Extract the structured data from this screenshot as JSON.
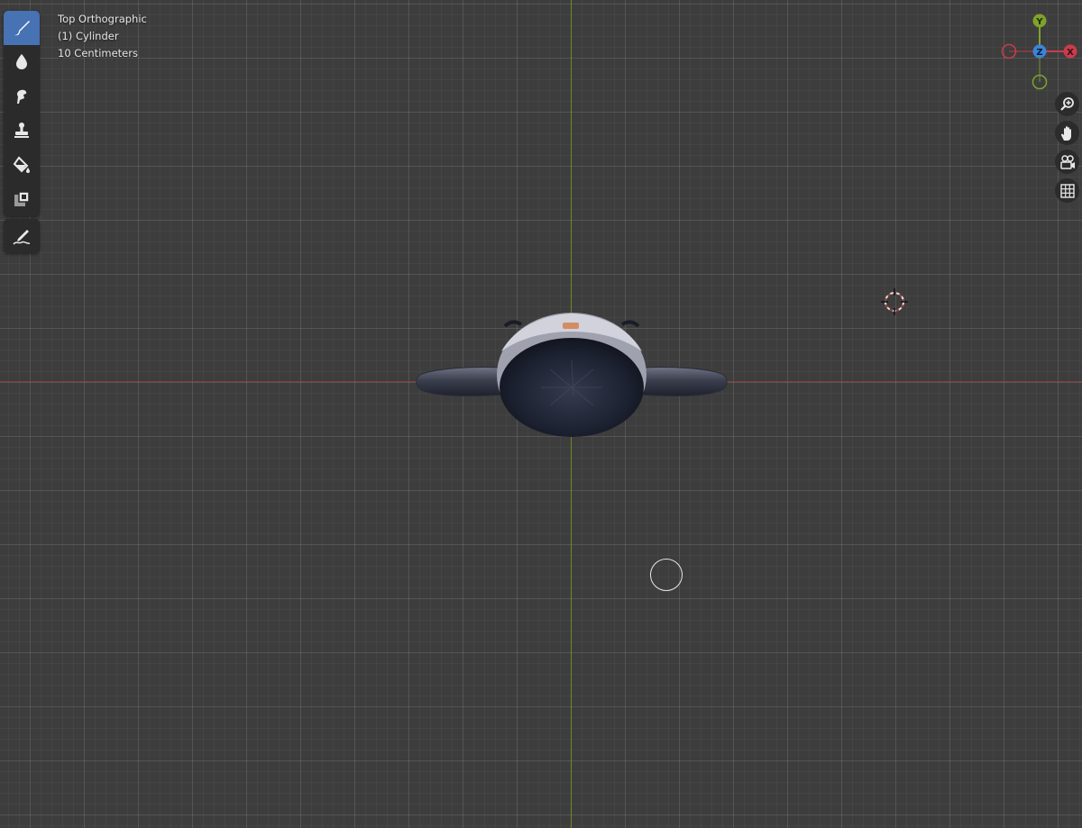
{
  "viewport": {
    "view_name": "Top Orthographic",
    "object_name": "(1) Cylinder",
    "scale_label": "10 Centimeters"
  },
  "colors": {
    "background": "#3d3d3d",
    "axis_x": "#8b3a43",
    "axis_y": "#6c8a2c",
    "active_tool": "#4772b3",
    "gizmo_x": "#c93c4b",
    "gizmo_y": "#7ea32d",
    "gizmo_z": "#3d84d6"
  },
  "tools": [
    {
      "name": "draw-brush-icon",
      "active": true
    },
    {
      "name": "blur-drop-icon",
      "active": false
    },
    {
      "name": "smear-icon",
      "active": false
    },
    {
      "name": "clone-stamp-icon",
      "active": false
    },
    {
      "name": "fill-bucket-icon",
      "active": false
    },
    {
      "name": "mask-icon",
      "active": false
    },
    {
      "name": "annotate-icon",
      "active": false
    }
  ],
  "gizmo": {
    "x_label": "X",
    "y_label": "Y",
    "z_label": "Z"
  },
  "nav_buttons": [
    "zoom-icon",
    "pan-hand-icon",
    "camera-view-icon",
    "ortho-grid-icon"
  ]
}
